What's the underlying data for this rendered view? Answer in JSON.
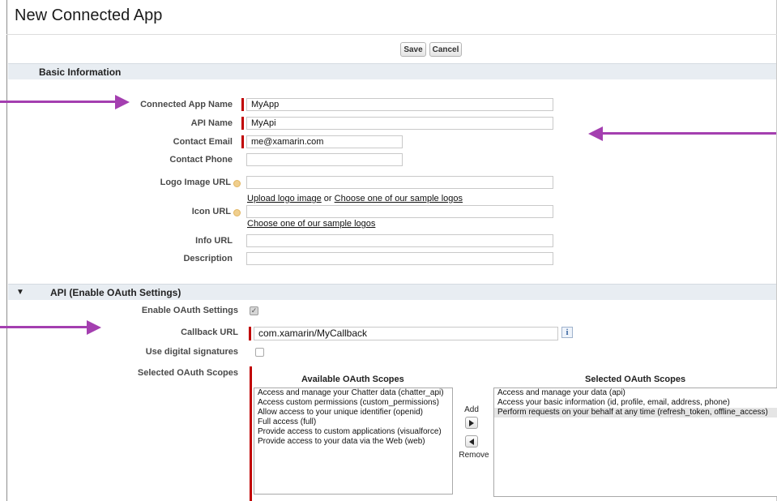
{
  "page": {
    "title": "New Connected App"
  },
  "toolbar": {
    "save_label": "Save",
    "cancel_label": "Cancel"
  },
  "basic": {
    "section_title": "Basic Information",
    "app_name_label": "Connected App Name",
    "app_name_value": "MyApp",
    "api_name_label": "API Name",
    "api_name_value": "MyApi",
    "contact_email_label": "Contact Email",
    "contact_email_value": "me@xamarin.com",
    "contact_phone_label": "Contact Phone",
    "logo_url_label": "Logo Image URL",
    "upload_logo_link": "Upload logo image",
    "or_text": " or ",
    "choose_sample_logo_link": "Choose one of our sample logos",
    "icon_url_label": "Icon URL",
    "choose_sample_icon_link": "Choose one of our sample logos",
    "info_url_label": "Info URL",
    "description_label": "Description"
  },
  "oauth": {
    "section_title": "API (Enable OAuth Settings)",
    "toggle_glyph": "▼",
    "enable_label": "Enable OAuth Settings",
    "enable_checked": true,
    "callback_label": "Callback URL",
    "callback_value": "com.xamarin/MyCallback",
    "info_glyph": "i",
    "digital_sig_label": "Use digital signatures",
    "digital_sig_checked": false,
    "scopes_label": "Selected OAuth Scopes",
    "available_title": "Available OAuth Scopes",
    "available_scopes": [
      "Access and manage your Chatter data (chatter_api)",
      "Access custom permissions (custom_permissions)",
      "Allow access to your unique identifier (openid)",
      "Full access (full)",
      "Provide access to custom applications (visualforce)",
      "Provide access to your data via the Web (web)"
    ],
    "selected_title": "Selected OAuth Scopes",
    "selected_scopes": [
      "Access and manage your data (api)",
      "Access your basic information (id, profile, email, address, phone)",
      "Perform requests on your behalf at any time (refresh_token, offline_access)"
    ],
    "highlighted_selected_index": 2,
    "add_label": "Add",
    "remove_label": "Remove"
  },
  "colors": {
    "annotation_arrow": "#a43fb0",
    "required_marker": "#c00000",
    "section_bar": "#e8edf2"
  }
}
